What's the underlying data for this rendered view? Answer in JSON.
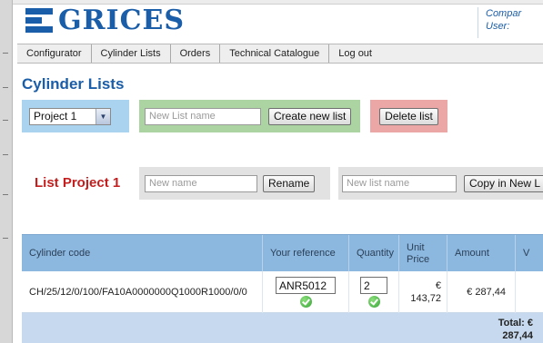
{
  "app": {
    "logo_text": "GRICES"
  },
  "user_info": {
    "line1": "Compar",
    "line2": "User:"
  },
  "nav": {
    "items": [
      "Configurator",
      "Cylinder Lists",
      "Orders",
      "Technical Catalogue",
      "Log out"
    ]
  },
  "page": {
    "title": "Cylinder Lists"
  },
  "project_select": {
    "value": "Project 1"
  },
  "new_list": {
    "placeholder": "New List name",
    "button_label": "Create new list"
  },
  "delete_list": {
    "button_label": "Delete list"
  },
  "list": {
    "title": "List Project 1",
    "rename_placeholder": "New name",
    "rename_button": "Rename",
    "copy_placeholder": "New list name",
    "copy_button": "Copy in New L"
  },
  "table": {
    "headers": [
      "Cylinder code",
      "Your reference",
      "Quantity",
      "Unit Price",
      "Amount",
      "V"
    ],
    "rows": [
      {
        "code": "CH/25/12/0/100/FA10A0000000Q1000R1000/0/0",
        "reference": "ANR5012",
        "quantity": "2",
        "unit_price_currency": "€",
        "unit_price_value": "143,72",
        "amount": "€ 287,44"
      }
    ],
    "total_line1": "Total: €",
    "total_line2": "287,44"
  },
  "colors": {
    "brand_blue": "#1a5da8",
    "list_title_red": "#c41e1e",
    "panel_blue": "#a9d3ef",
    "panel_green": "#acd3a2",
    "panel_red": "#eba6a6",
    "table_header": "#8cb8df"
  },
  "icons": {
    "logo": "grices-logo-icon",
    "select_arrow": "chevron-down-icon",
    "ok": "check-circle-icon"
  }
}
